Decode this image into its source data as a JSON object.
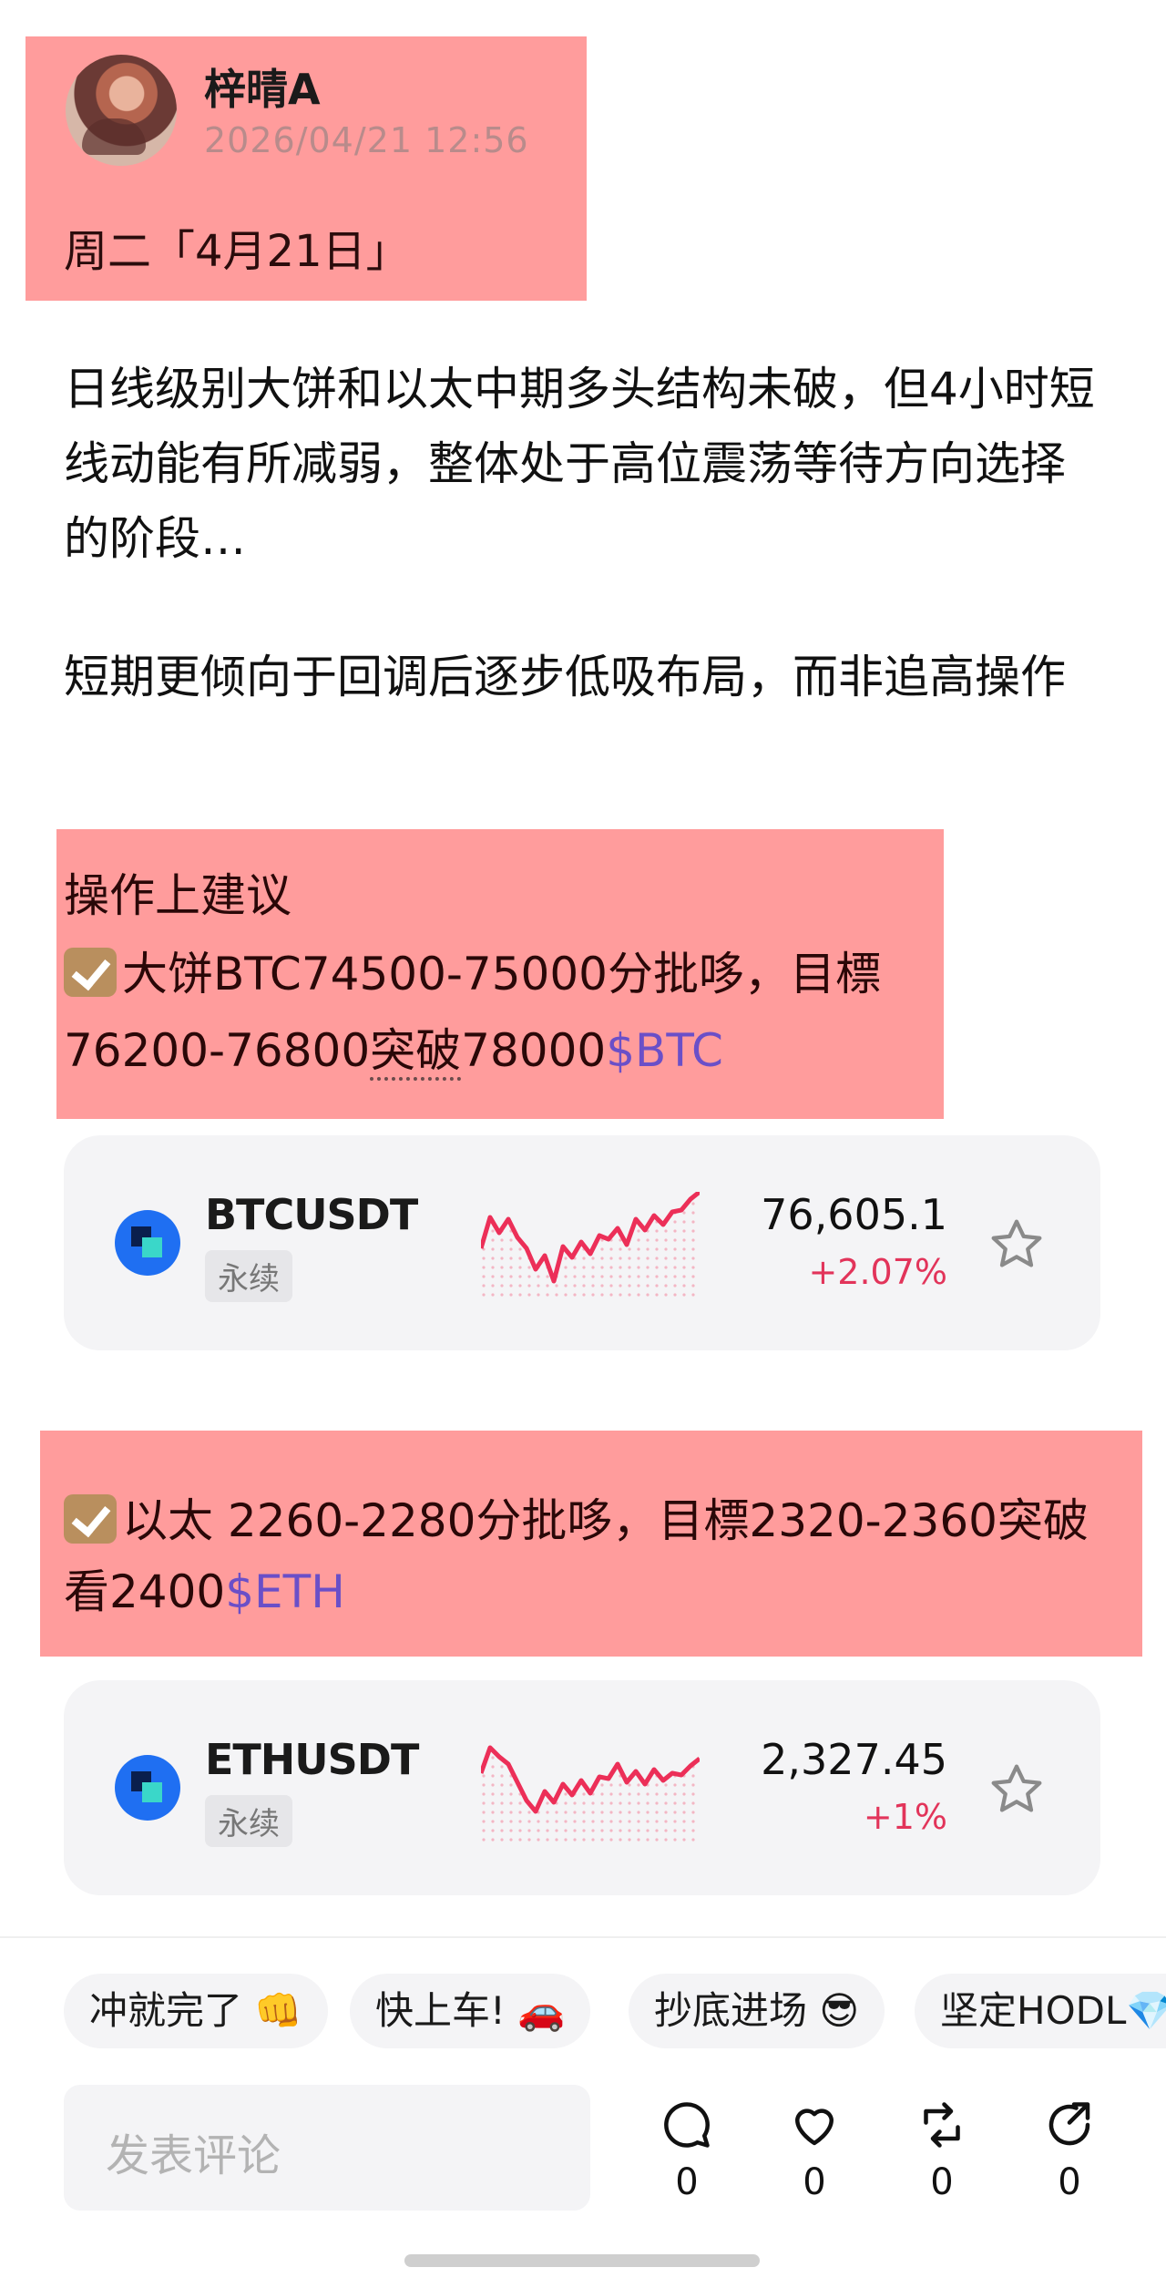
{
  "post": {
    "author": "梓晴A",
    "timestamp": "2026/04/21 12:56",
    "day_title": "周二「4月21日」",
    "paragraph1": "日线级别大饼和以太中期多头结构未破，但4小时短线动能有所减弱，整体处于高位震荡等待方向选择的阶段…",
    "paragraph2": "短期更倾向于回调后逐步低吸布局，而非追高操作"
  },
  "tip_btc": {
    "heading": "操作上建议",
    "line1": "大饼BTC74500-75000分批哆，目標",
    "line2_a": "76200-76800",
    "line2_b": "突破",
    "line2_c": "78000",
    "ticker": "$BTC"
  },
  "tip_eth": {
    "line1": "以太 2260-2280分批哆，目標2320-2360突破",
    "line2_a": "看2400",
    "ticker": "$ETH"
  },
  "cards": [
    {
      "symbol": "BTCUSDT",
      "type": "永续",
      "price": "76,605.1",
      "change": "+2.07%"
    },
    {
      "symbol": "ETHUSDT",
      "type": "永续",
      "price": "2,327.45",
      "change": "+1%"
    }
  ],
  "reactions": [
    {
      "label": "冲就完了 👊"
    },
    {
      "label": "快上车! 🚗"
    },
    {
      "label": "抄底进场 😎"
    },
    {
      "label": "坚定HODL💎"
    }
  ],
  "comment": {
    "placeholder": "发表评论"
  },
  "actions": [
    {
      "name": "comment",
      "count": "0"
    },
    {
      "name": "like",
      "count": "0"
    },
    {
      "name": "repost",
      "count": "0"
    },
    {
      "name": "share",
      "count": "0"
    }
  ],
  "colors": {
    "highlight": "#ff9c9c",
    "positive": "#e2345a",
    "ticker": "#6a4fc8",
    "coin_icon": "#1f6ff2"
  }
}
